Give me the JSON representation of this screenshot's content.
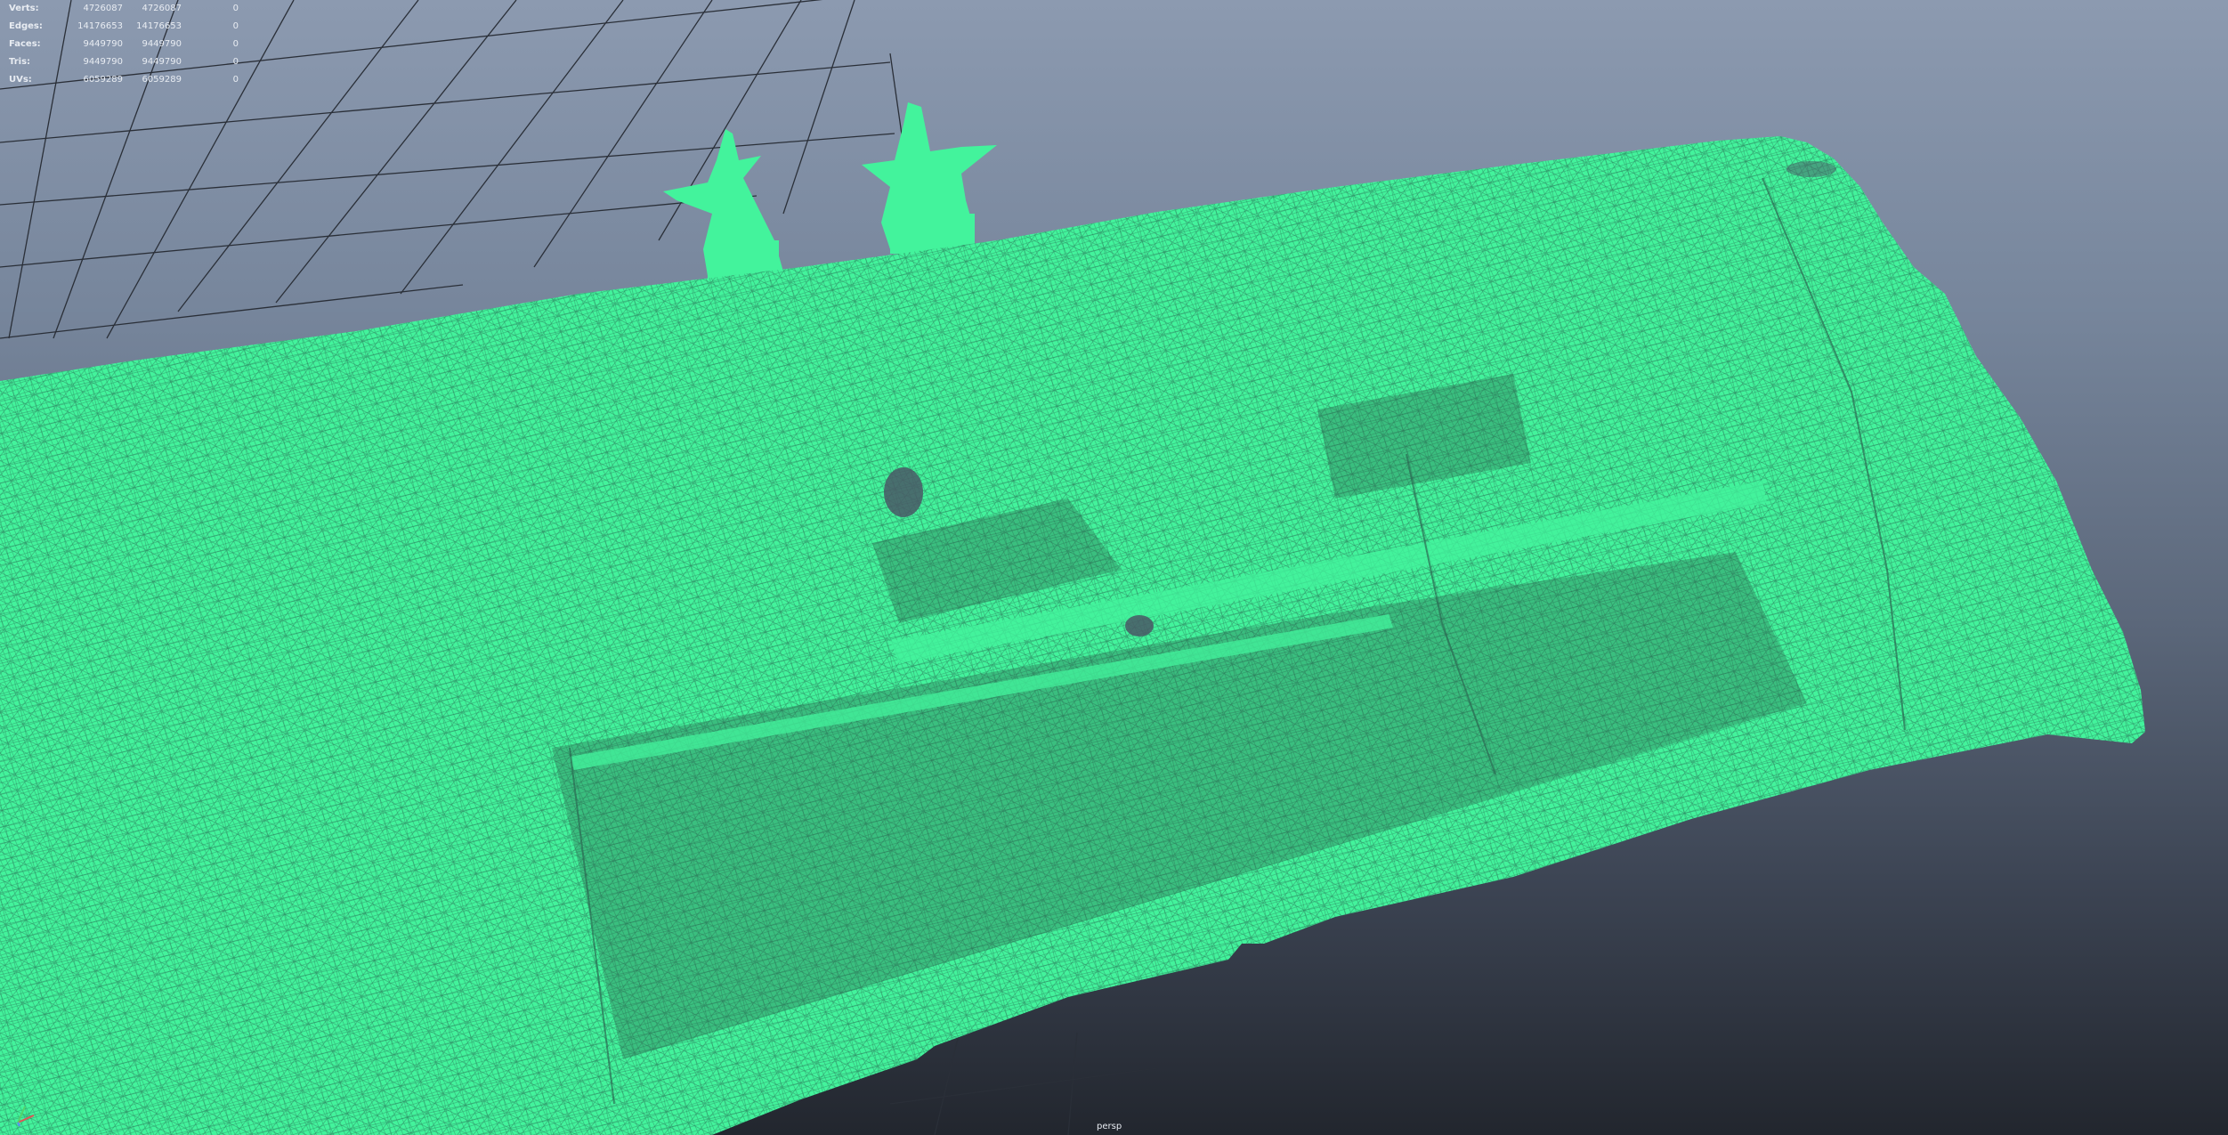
{
  "hud": {
    "rows": [
      {
        "label": "Verts:",
        "v1": "4726087",
        "v2": "4726087",
        "v3": "0"
      },
      {
        "label": "Edges:",
        "v1": "14176653",
        "v2": "14176653",
        "v3": "0"
      },
      {
        "label": "Faces:",
        "v1": "9449790",
        "v2": "9449790",
        "v3": "0"
      },
      {
        "label": "Tris:",
        "v1": "9449790",
        "v2": "9449790",
        "v3": "0"
      },
      {
        "label": "UVs:",
        "v1": "6059289",
        "v2": "6059289",
        "v3": "0"
      }
    ]
  },
  "camera": {
    "name": "persp"
  },
  "colors": {
    "mesh": "#43f39c",
    "wire": "#2a6a54",
    "grid": "#2a2f38"
  },
  "icons": {
    "axis": "xyz-axis-gizmo-icon"
  }
}
